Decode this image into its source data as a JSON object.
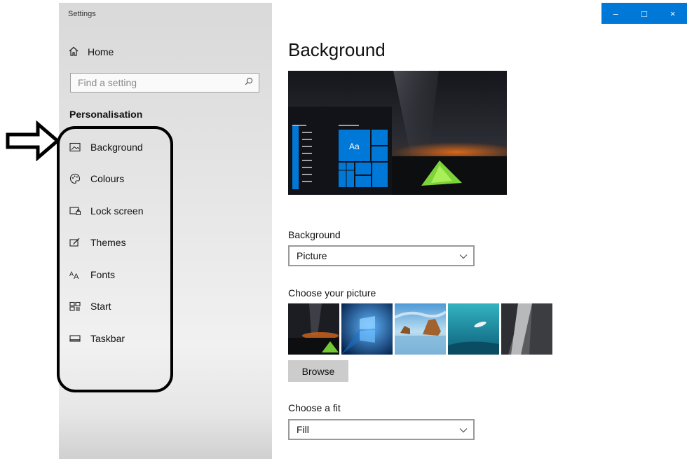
{
  "window": {
    "app_title": "Settings",
    "controls": {
      "minimize": "–",
      "maximize": "□",
      "close": "×"
    }
  },
  "sidebar": {
    "home_label": "Home",
    "search_placeholder": "Find a setting",
    "section_title": "Personalisation",
    "items": [
      {
        "label": "Background",
        "icon": "picture-icon",
        "selected": true
      },
      {
        "label": "Colours",
        "icon": "palette-icon"
      },
      {
        "label": "Lock screen",
        "icon": "lock-screen-icon"
      },
      {
        "label": "Themes",
        "icon": "brush-icon"
      },
      {
        "label": "Fonts",
        "icon": "font-icon"
      },
      {
        "label": "Start",
        "icon": "start-tiles-icon"
      },
      {
        "label": "Taskbar",
        "icon": "taskbar-icon"
      }
    ]
  },
  "main": {
    "title": "Background",
    "preview_tile_text": "Aa",
    "background_label": "Background",
    "background_value": "Picture",
    "choose_picture_label": "Choose your picture",
    "browse_label": "Browse",
    "choose_fit_label": "Choose a fit",
    "fit_value": "Fill"
  },
  "colors": {
    "accent": "#0078d7",
    "sidebar_bg": "#e6e6e6"
  }
}
